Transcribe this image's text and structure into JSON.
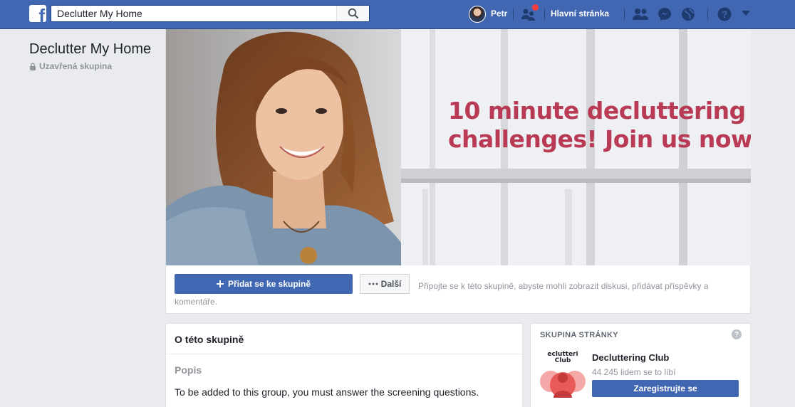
{
  "colors": {
    "brand_blue": "#4267b2",
    "background": "#e9ebee",
    "cover_text": "#b93a55",
    "notification": "#fa3e3e"
  },
  "topbar": {
    "logo_letter": "f",
    "search_value": "Declutter My Home",
    "user_name": "Petr",
    "home_label": "Hlavní stránka",
    "icons": [
      "facebook-logo-icon",
      "search-icon",
      "friend-requests-icon",
      "people-icon",
      "messenger-icon",
      "globe-icon",
      "help-icon",
      "dropdown-arrow-icon"
    ]
  },
  "group": {
    "name": "Declutter My Home",
    "privacy": "Uzavřená skupina"
  },
  "cover": {
    "line1": "10 minute decluttering",
    "line2": "challenges! Join us now."
  },
  "actions": {
    "join_label": "Přidat se ke skupině",
    "more_label": "Další",
    "hint": "Připojte se k této skupině, abyste mohli zobrazit diskusi, přidávat příspěvky a komentáře."
  },
  "about": {
    "title": "O této skupině",
    "label": "Popis",
    "text": "To be added to this group, you must answer the screening questions."
  },
  "page_card": {
    "header": "SKUPINA STRÁNKY",
    "help": "?",
    "thumb_text_1": "eclutteri",
    "thumb_text_2": "Club",
    "name": "Decluttering Club",
    "likes": "44 245 lidem se to líbí",
    "register_label": "Zaregistrujte se"
  }
}
